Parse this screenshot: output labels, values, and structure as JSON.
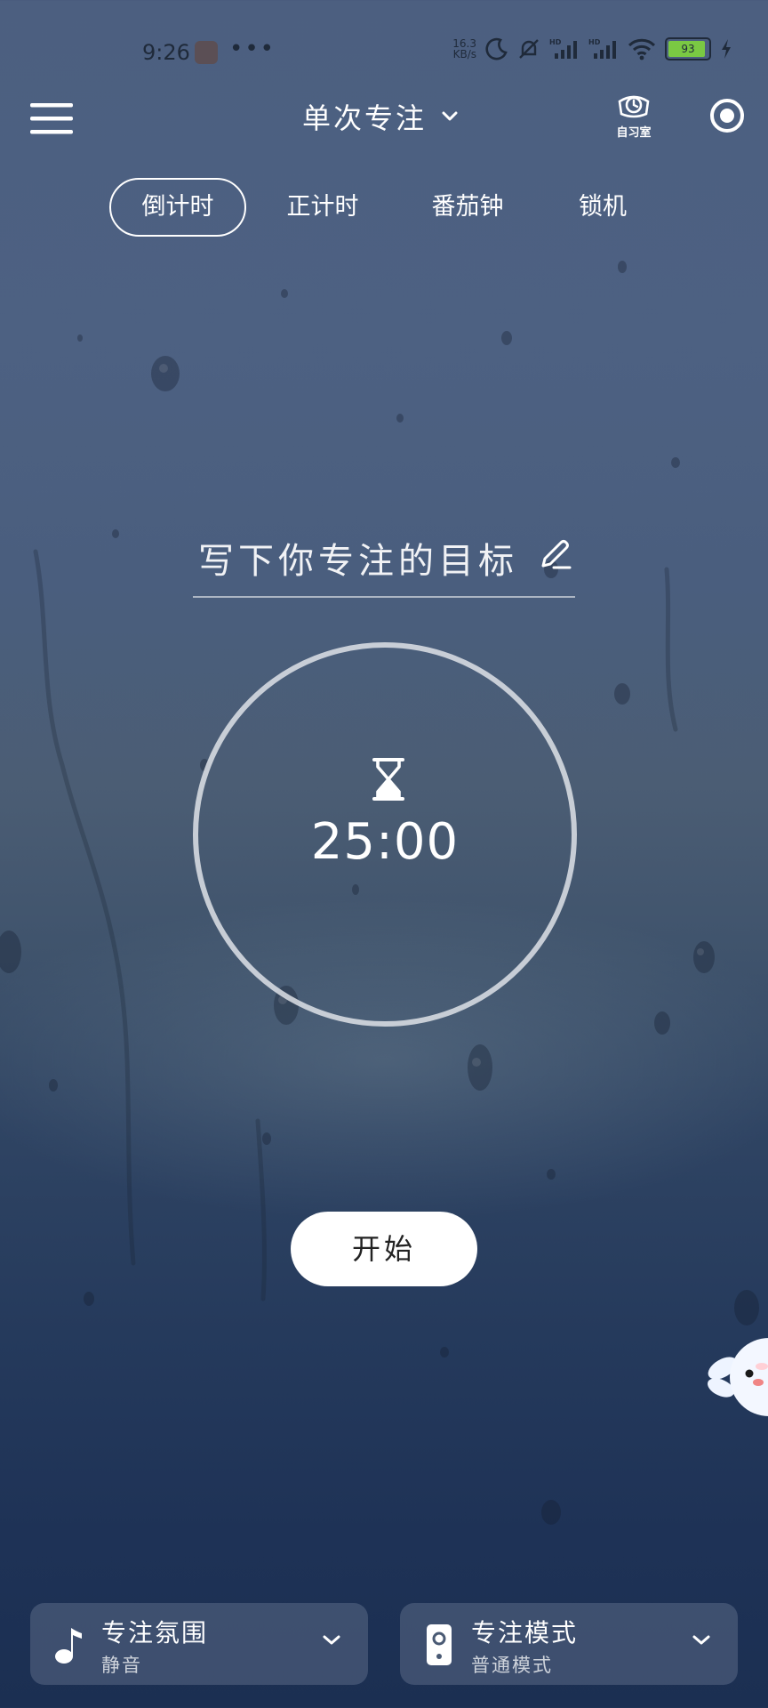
{
  "status_bar": {
    "time": "9:26",
    "net_speed_value": "16.3",
    "net_speed_unit": "KB/s",
    "battery": "93"
  },
  "header": {
    "title": "单次专注",
    "study_room_label": "自习室"
  },
  "tabs": [
    {
      "label": "倒计时",
      "active": true
    },
    {
      "label": "正计时",
      "active": false
    },
    {
      "label": "番茄钟",
      "active": false
    },
    {
      "label": "锁机",
      "active": false
    }
  ],
  "goal": {
    "placeholder": "写下你专注的目标"
  },
  "timer": {
    "value": "25:00"
  },
  "start_button": {
    "label": "开始"
  },
  "bottom_cards": {
    "atmosphere": {
      "title": "专注氛围",
      "subtitle": "静音"
    },
    "mode": {
      "title": "专注模式",
      "subtitle": "普通模式"
    }
  },
  "colors": {
    "background_top": "#4c5f80",
    "background_bottom": "#1b2f52",
    "battery_fill": "#7ac943"
  },
  "icons": {
    "menu": "hamburger-menu-icon",
    "dropdown": "chevron-down-icon",
    "study_room": "alarm-clock-icon",
    "record": "record-icon",
    "edit": "pencil-icon",
    "timer": "hourglass-icon",
    "music": "music-note-icon",
    "phone": "phone-icon"
  }
}
